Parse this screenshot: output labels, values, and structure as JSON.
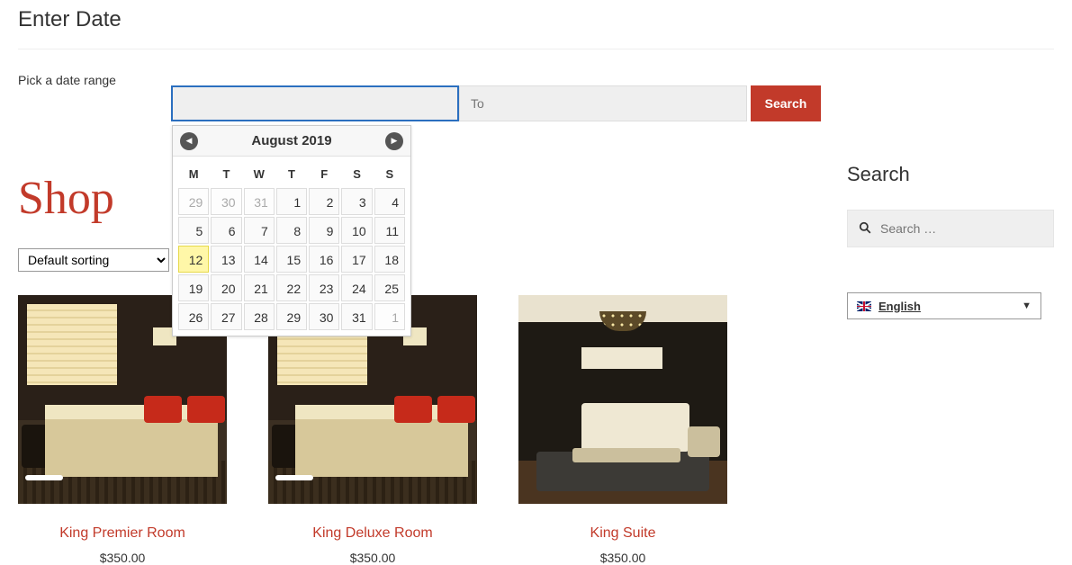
{
  "header": {
    "title": "Enter Date",
    "pick_label": "Pick a date range"
  },
  "date_form": {
    "from_value": "",
    "to_placeholder": "To",
    "search_label": "Search"
  },
  "datepicker": {
    "month_label": "August 2019",
    "weekdays": [
      "M",
      "T",
      "W",
      "T",
      "F",
      "S",
      "S"
    ],
    "rows": [
      [
        {
          "n": "29",
          "other": true
        },
        {
          "n": "30",
          "other": true
        },
        {
          "n": "31",
          "other": true
        },
        {
          "n": "1"
        },
        {
          "n": "2"
        },
        {
          "n": "3"
        },
        {
          "n": "4"
        }
      ],
      [
        {
          "n": "5"
        },
        {
          "n": "6"
        },
        {
          "n": "7"
        },
        {
          "n": "8"
        },
        {
          "n": "9"
        },
        {
          "n": "10"
        },
        {
          "n": "11"
        }
      ],
      [
        {
          "n": "12",
          "today": true
        },
        {
          "n": "13"
        },
        {
          "n": "14"
        },
        {
          "n": "15"
        },
        {
          "n": "16"
        },
        {
          "n": "17"
        },
        {
          "n": "18"
        }
      ],
      [
        {
          "n": "19"
        },
        {
          "n": "20"
        },
        {
          "n": "21"
        },
        {
          "n": "22"
        },
        {
          "n": "23"
        },
        {
          "n": "24"
        },
        {
          "n": "25"
        }
      ],
      [
        {
          "n": "26"
        },
        {
          "n": "27"
        },
        {
          "n": "28"
        },
        {
          "n": "29"
        },
        {
          "n": "30"
        },
        {
          "n": "31"
        },
        {
          "n": "1",
          "other": true
        }
      ]
    ]
  },
  "shop": {
    "heading": "Shop",
    "sort_selected": "Default sorting",
    "products": [
      {
        "title": "King Premier Room",
        "price": "$350.00"
      },
      {
        "title": "King Deluxe Room",
        "price": "$350.00"
      },
      {
        "title": "King Suite",
        "price": "$350.00"
      }
    ]
  },
  "sidebar": {
    "search_heading": "Search",
    "search_placeholder": "Search …",
    "language_label": "English"
  }
}
